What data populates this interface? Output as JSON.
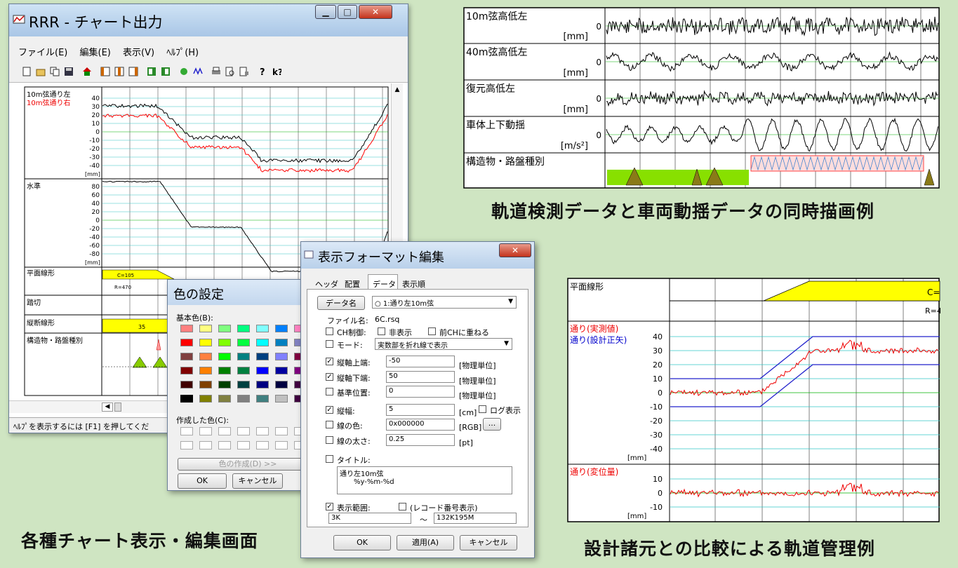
{
  "main_window": {
    "title": "RRR - チャート出力",
    "menu": [
      "ファイル(E)",
      "編集(E)",
      "表示(V)",
      "ﾍﾙﾌﾟ(H)"
    ],
    "status": "ﾍﾙﾌﾟを表示するには [F1] を押してくだ",
    "chart": {
      "track1": {
        "label_left": "10m弦通り左",
        "label_right": "10m弦通り右",
        "unit": "[mm]",
        "ticks": [
          "40",
          "30",
          "20",
          "10",
          "0",
          "-10",
          "-20",
          "-30",
          "-40"
        ]
      },
      "track2": {
        "label": "水準",
        "unit": "[mm]",
        "ticks": [
          "80",
          "60",
          "40",
          "20",
          "0",
          "-20",
          "-40",
          "-60",
          "-80"
        ]
      },
      "track3": {
        "label": "平面線形",
        "marker1": "C=105",
        "marker2": "R=470",
        "marker3": "R="
      },
      "track4": {
        "label": "踏切"
      },
      "track5": {
        "label": "縦断線形",
        "marker": "35"
      },
      "track6": {
        "label": "構造物・路盤種別"
      }
    },
    "colors": {
      "left": "#000000",
      "right": "#ff0000",
      "grid": "#33c6c6",
      "zero": "#00b000",
      "yellow": "#ffff00"
    }
  },
  "color_dialog": {
    "title": "色の設定",
    "basic_label": "基本色(B):",
    "custom_label": "作成した色(C):",
    "define_button": "色の作成(D) >>",
    "ok": "OK",
    "cancel": "キャンセル",
    "swatches": [
      "#ff8080",
      "#ffff80",
      "#80ff80",
      "#00ff80",
      "#80ffff",
      "#0080ff",
      "#ff80c0",
      "#ff80ff",
      "#ff0000",
      "#ffff00",
      "#80ff00",
      "#00ff40",
      "#00ffff",
      "#0080c0",
      "#8080c0",
      "#ff00ff",
      "#804040",
      "#ff8040",
      "#00ff00",
      "#008080",
      "#004080",
      "#8080ff",
      "#800040",
      "#ff0080",
      "#800000",
      "#ff8000",
      "#008000",
      "#008040",
      "#0000ff",
      "#0000a0",
      "#800080",
      "#8000ff",
      "#400000",
      "#804000",
      "#004000",
      "#004040",
      "#000080",
      "#000040",
      "#400040",
      "#400080",
      "#000000",
      "#808000",
      "#808040",
      "#808080",
      "#408080",
      "#c0c0c0",
      "#400040",
      "#ffffff"
    ]
  },
  "format_dialog": {
    "title": "表示フォーマット編集",
    "tabs": [
      "ヘッダ",
      "配置",
      "データ",
      "表示順"
    ],
    "data_button": "データ名",
    "data_select": "1:通り左10m弦",
    "file_label": "ファイル名:",
    "file_value": "6C.rsq",
    "ch_label": "CH制御:",
    "ch_opt1": "非表示",
    "ch_opt2": "前CHに重ねる",
    "mode_label": "モード:",
    "mode_value": "実数部を折れ線で表示",
    "top_label": "縦軸上端:",
    "top_value": "-50",
    "bottom_label": "縦軸下端:",
    "bottom_value": "50",
    "base_label": "基準位置:",
    "base_value": "0",
    "unit_phys": "[物理単位]",
    "width_label": "縦幅:",
    "width_value": "5",
    "unit_cm": "[cm]",
    "log_label": "ログ表示",
    "color_label": "線の色:",
    "color_value": "0x000000",
    "unit_rgb": "[RGB]",
    "ellipsis": "...",
    "thick_label": "線の太さ:",
    "thick_value": "0.25",
    "unit_pt": "[pt]",
    "title_label": "タイトル:",
    "title_text1": "通り左10m弦",
    "title_text2": "%y-%m-%d",
    "range_label": "表示範囲:",
    "record_label": "(レコード番号表示)",
    "range_from": "3K",
    "range_sep": "〜",
    "range_to": "132K195M",
    "ok": "OK",
    "apply": "適用(A)",
    "cancel": "キャンセル"
  },
  "top_right": {
    "rows": [
      {
        "label": "10m弦高低左",
        "unit": "[mm]"
      },
      {
        "label": "40m弦高低左",
        "unit": "[mm]"
      },
      {
        "label": "復元高低左",
        "unit": "[mm]"
      },
      {
        "label": "車体上下動揺",
        "unit": "[m/s²]"
      },
      {
        "label": "構造物・路盤種別",
        "unit": ""
      }
    ],
    "zero": "0"
  },
  "bottom_right": {
    "row1_label": "平面線形",
    "marker_c": "C=",
    "marker_r": "R=4",
    "row2_label1": "通り(実測値)",
    "row2_label2": "通り(設計正矢)",
    "row2_ticks": [
      "40",
      "30",
      "20",
      "10",
      "0",
      "-10",
      "-20",
      "-30",
      "-40"
    ],
    "unit": "[mm]",
    "row3_label": "通り(変位量)",
    "row3_ticks": [
      "10",
      "0",
      "-10"
    ]
  },
  "captions": {
    "top_right": "軌道検測データと車両動揺データの同時描画例",
    "bottom_left": "各種チャート表示・編集画面",
    "bottom_right": "設計諸元との比較による軌道管理例"
  }
}
